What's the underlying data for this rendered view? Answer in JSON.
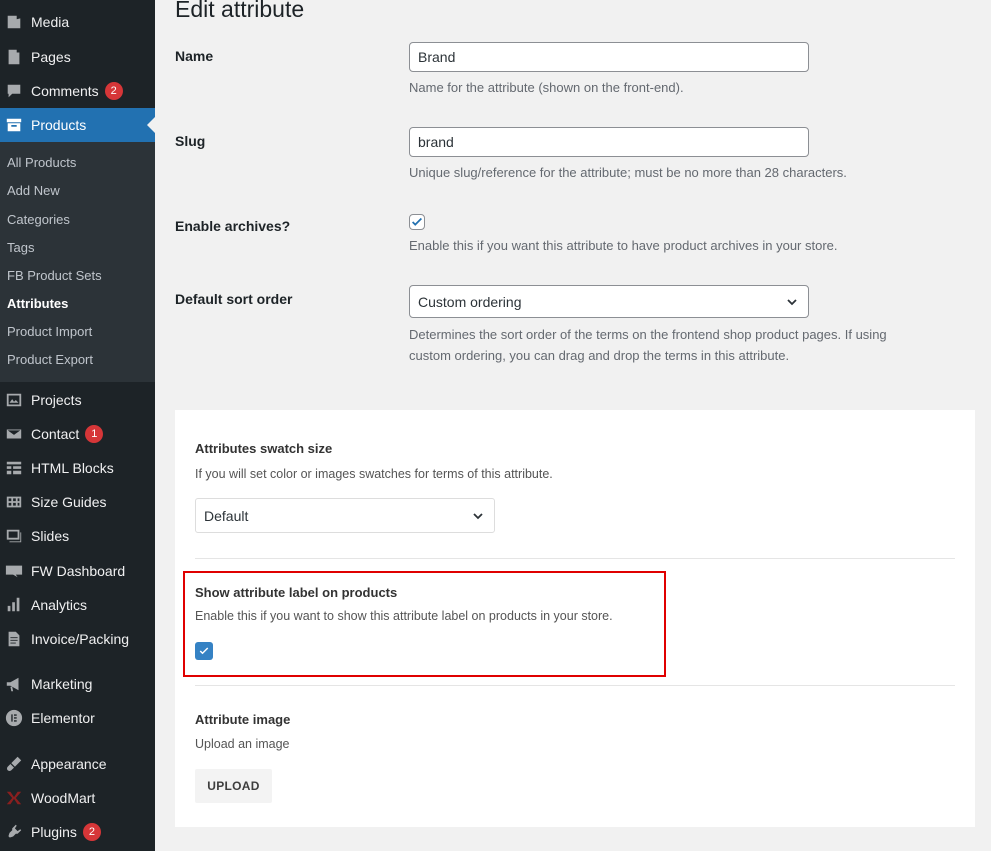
{
  "sidebar": {
    "menu": [
      {
        "label": "Media",
        "icon": "media-icon"
      },
      {
        "label": "Pages",
        "icon": "pages-icon"
      },
      {
        "label": "Comments",
        "icon": "comments-icon",
        "badge": "2"
      },
      {
        "label": "Products",
        "icon": "products-icon",
        "active": true
      },
      {
        "label": "Projects",
        "icon": "projects-icon"
      },
      {
        "label": "Contact",
        "icon": "contact-icon",
        "badge": "1"
      },
      {
        "label": "HTML Blocks",
        "icon": "html-blocks-icon"
      },
      {
        "label": "Size Guides",
        "icon": "size-guides-icon"
      },
      {
        "label": "Slides",
        "icon": "slides-icon"
      },
      {
        "label": "FW Dashboard",
        "icon": "woo-icon"
      },
      {
        "label": "Analytics",
        "icon": "analytics-icon"
      },
      {
        "label": "Invoice/Packing",
        "icon": "invoice-icon"
      },
      {
        "label": "Marketing",
        "icon": "marketing-icon"
      },
      {
        "label": "Elementor",
        "icon": "elementor-icon"
      },
      {
        "label": "Appearance",
        "icon": "appearance-icon"
      },
      {
        "label": "WoodMart",
        "icon": "woodmart-icon"
      },
      {
        "label": "Plugins",
        "icon": "plugins-icon",
        "badge": "2"
      }
    ],
    "submenu": [
      "All Products",
      "Add New",
      "Categories",
      "Tags",
      "FB Product Sets",
      "Attributes",
      "Product Import",
      "Product Export"
    ],
    "submenu_current": "Attributes"
  },
  "page": {
    "title": "Edit attribute"
  },
  "form": {
    "name": {
      "label": "Name",
      "value": "Brand",
      "desc": "Name for the attribute (shown on the front-end)."
    },
    "slug": {
      "label": "Slug",
      "value": "brand",
      "desc": "Unique slug/reference for the attribute; must be no more than 28 characters."
    },
    "archives": {
      "label": "Enable archives?",
      "checked": true,
      "desc": "Enable this if you want this attribute to have product archives in your store."
    },
    "sort": {
      "label": "Default sort order",
      "value": "Custom ordering",
      "desc_line1": "Determines the sort order of the terms on the frontend shop product pages. If using",
      "desc_line2": "custom ordering, you can drag and drop the terms in this attribute."
    }
  },
  "panel": {
    "swatch": {
      "title": "Attributes swatch size",
      "desc": "If you will set color or images swatches for terms of this attribute.",
      "value": "Default"
    },
    "show_label": {
      "title": "Show attribute label on products",
      "desc": "Enable this if you want to show this attribute label on products in your store.",
      "checked": true
    },
    "image": {
      "title": "Attribute image",
      "desc": "Upload an image",
      "button": "UPLOAD"
    }
  },
  "colors": {
    "sidebar_bg": "#1d2327",
    "submenu_bg": "#2c3338",
    "active": "#2271b1",
    "badge": "#d63638",
    "highlight": "#e00000",
    "check_blue": "#3582c4"
  }
}
